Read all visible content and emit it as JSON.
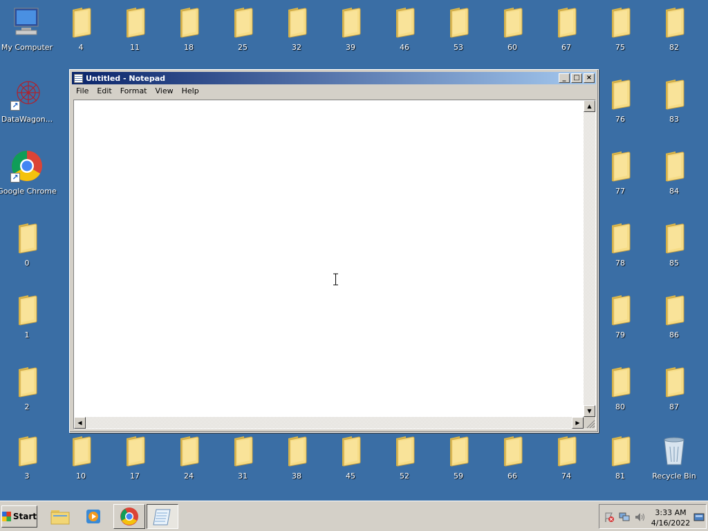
{
  "desktop": {
    "system_icons": [
      {
        "label": "My Computer",
        "name": "my-computer-icon"
      },
      {
        "label": "DataWagon...",
        "name": "datawagon-shortcut-icon"
      },
      {
        "label": "Google Chrome",
        "name": "google-chrome-shortcut-icon"
      },
      {
        "label": "Recycle Bin",
        "name": "recycle-bin-icon"
      }
    ],
    "folder_labels": {
      "top_row": [
        "4",
        "11",
        "18",
        "25",
        "32",
        "39",
        "46",
        "53",
        "60",
        "67",
        "75",
        "82"
      ],
      "left_column": [
        "0",
        "1",
        "2",
        "3"
      ],
      "bottom_row": [
        "10",
        "17",
        "24",
        "31",
        "38",
        "45",
        "52",
        "59",
        "66",
        "74",
        "81"
      ],
      "right_column_a": [
        "76",
        "77",
        "78",
        "79",
        "80"
      ],
      "right_column_b": [
        "83",
        "84",
        "85",
        "86",
        "87"
      ]
    }
  },
  "notepad": {
    "title": "Untitled - Notepad",
    "menu": [
      "File",
      "Edit",
      "Format",
      "View",
      "Help"
    ],
    "content": "",
    "buttons": {
      "minimize": "_",
      "maximize": "□",
      "close": "×"
    }
  },
  "taskbar": {
    "start_label": "Start",
    "items": [
      {
        "name": "taskbar-explorer",
        "icon": "folder-icon"
      },
      {
        "name": "taskbar-media-player",
        "icon": "media-player-icon"
      },
      {
        "name": "taskbar-chrome",
        "icon": "chrome-icon"
      },
      {
        "name": "taskbar-notepad",
        "icon": "notepad-icon"
      }
    ],
    "clock": {
      "time": "3:33 AM",
      "date": "4/16/2022"
    }
  }
}
